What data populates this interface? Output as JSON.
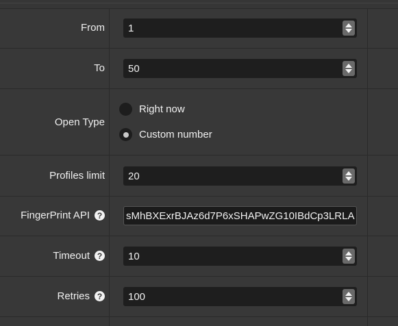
{
  "form": {
    "from": {
      "label": "From",
      "value": "1"
    },
    "to": {
      "label": "To",
      "value": "50"
    },
    "open_type": {
      "label": "Open Type",
      "options": [
        {
          "label": "Right now",
          "selected": false
        },
        {
          "label": "Custom number",
          "selected": true
        }
      ]
    },
    "profiles_limit": {
      "label": "Profiles limit",
      "value": "20"
    },
    "fingerprint_api": {
      "label": "FingerPrint API",
      "help": "?",
      "value": "sMhBXExrBJAz6d7P6xSHAPwZG10IBdCp3LRLA"
    },
    "timeout": {
      "label": "Timeout",
      "help": "?",
      "value": "10"
    },
    "retries": {
      "label": "Retries",
      "help": "?",
      "value": "100"
    }
  },
  "icons": {
    "help": "help-circle-icon",
    "spinner": "spinner-arrows-icon",
    "radio": "radio-icon"
  },
  "colors": {
    "background": "#383838",
    "input_bg": "#1e1e1e",
    "border": "#2a2a2a",
    "text": "#f0f0f0",
    "help_icon": "#f2f2f2"
  }
}
